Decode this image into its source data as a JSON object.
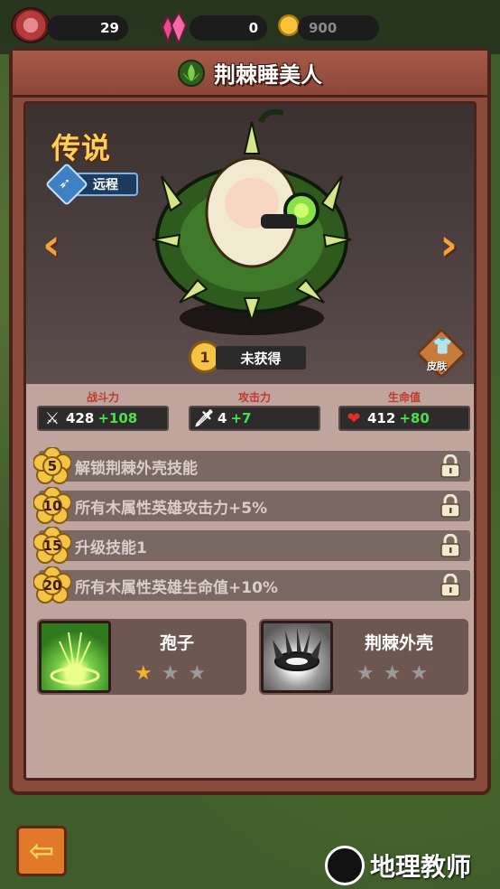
{
  "resources": {
    "meat": "29",
    "gems": "0",
    "coins": "900"
  },
  "hero": {
    "name": "荆棘睡美人",
    "rarity": "传说",
    "attack_type": "远程",
    "level": "1",
    "status": "未获得",
    "skin_label": "皮肤"
  },
  "stats": [
    {
      "label": "战斗力",
      "base": "428",
      "bonus": "+108",
      "icon": "swords-icon"
    },
    {
      "label": "攻击力",
      "base": "4",
      "bonus": "+7",
      "icon": "sword-icon"
    },
    {
      "label": "生命值",
      "base": "412",
      "bonus": "+80",
      "icon": "heart-icon"
    }
  ],
  "unlocks": [
    {
      "level": "5",
      "text": "解锁荆棘外壳技能"
    },
    {
      "level": "10",
      "text": "所有木属性英雄攻击力+5%"
    },
    {
      "level": "15",
      "text": "升级技能1"
    },
    {
      "level": "20",
      "text": "所有木属性英雄生命值+10%"
    }
  ],
  "skills": [
    {
      "name": "孢子",
      "stars_filled": 1,
      "stars_total": 3
    },
    {
      "name": "荆棘外壳",
      "stars_filled": 0,
      "stars_total": 3
    }
  ],
  "watermark": "地理教师",
  "colors": {
    "rarity": "#f7d25a",
    "bonus_green": "#4be04b",
    "stat_label_red": "#c0392b",
    "star_on": "#f2b12a"
  }
}
